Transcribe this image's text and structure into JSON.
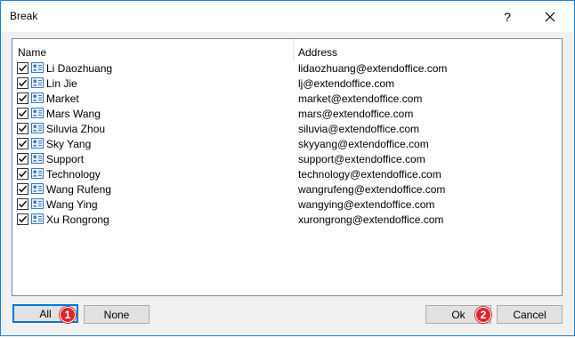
{
  "window": {
    "title": "Break",
    "help_label": "?"
  },
  "list": {
    "columns": [
      "Name",
      "Address"
    ],
    "rows": [
      {
        "name": "Li Daozhuang",
        "address": "lidaozhuang@extendoffice.com",
        "checked": true
      },
      {
        "name": "Lin Jie",
        "address": "lj@extendoffice.com",
        "checked": true
      },
      {
        "name": "Market",
        "address": "market@extendoffice.com",
        "checked": true
      },
      {
        "name": "Mars Wang",
        "address": "mars@extendoffice.com",
        "checked": true
      },
      {
        "name": "Siluvia Zhou",
        "address": "siluvia@extendoffice.com",
        "checked": true
      },
      {
        "name": "Sky Yang",
        "address": "skyyang@extendoffice.com",
        "checked": true
      },
      {
        "name": "Support",
        "address": "support@extendoffice.com",
        "checked": true
      },
      {
        "name": "Technology",
        "address": "technology@extendoffice.com",
        "checked": true
      },
      {
        "name": "Wang Rufeng",
        "address": "wangrufeng@extendoffice.com",
        "checked": true
      },
      {
        "name": "Wang Ying",
        "address": "wangying@extendoffice.com",
        "checked": true
      },
      {
        "name": "Xu Rongrong",
        "address": "xurongrong@extendoffice.com",
        "checked": true
      }
    ]
  },
  "buttons": {
    "all": "All",
    "none": "None",
    "ok": "Ok",
    "cancel": "Cancel"
  },
  "badges": {
    "first": "1",
    "second": "2"
  },
  "colors": {
    "accent": "#0078d7",
    "badge": "#d9262d",
    "border": "#1883d7"
  },
  "icons": {
    "row_icon": "contact-card-icon",
    "check": "check-icon",
    "close": "close-icon"
  }
}
